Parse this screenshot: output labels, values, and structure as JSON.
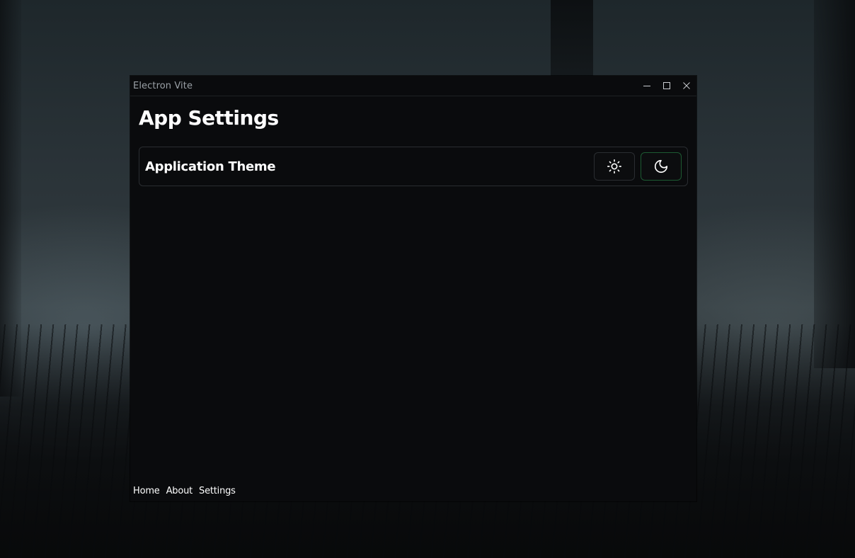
{
  "window": {
    "title": "Electron Vite"
  },
  "page": {
    "title": "App Settings"
  },
  "settings": {
    "theme": {
      "label": "Application Theme",
      "options": [
        {
          "icon": "sun-icon",
          "active": false
        },
        {
          "icon": "moon-icon",
          "active": true
        }
      ],
      "active_border_color": "#1d5a32"
    }
  },
  "footer_nav": {
    "home": "Home",
    "about": "About",
    "settings": "Settings"
  }
}
